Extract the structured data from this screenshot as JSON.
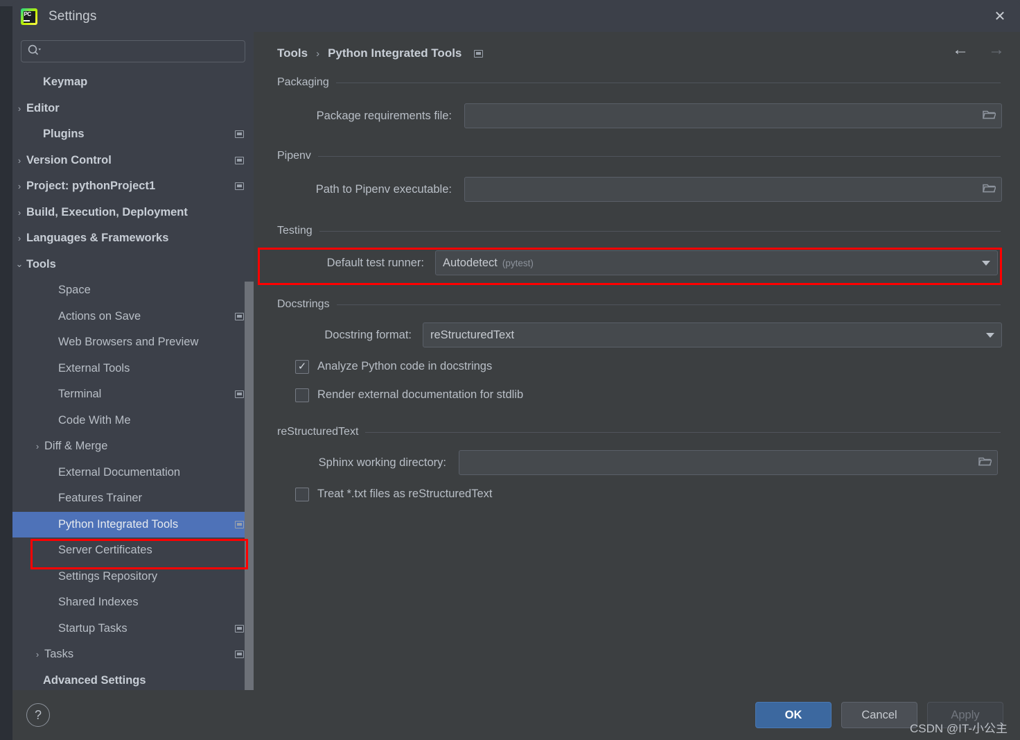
{
  "window": {
    "title": "Settings",
    "app_icon": "pycharm-logo",
    "close_icon": "✕"
  },
  "behind": {
    "left_ghost": "....... ....... ... ....... ......",
    "right_ghost": "………  ………"
  },
  "sidebar": {
    "search": {
      "placeholder": "",
      "value": "",
      "icon": "search-icon"
    },
    "items": [
      {
        "label": "Keymap",
        "arrow": "",
        "badge": false,
        "bold": true,
        "indent": 44,
        "selected": false
      },
      {
        "label": "Editor",
        "arrow": "›",
        "badge": false,
        "bold": true,
        "indent": 20,
        "selected": false
      },
      {
        "label": "Plugins",
        "arrow": "",
        "badge": true,
        "bold": true,
        "indent": 44,
        "selected": false
      },
      {
        "label": "Version Control",
        "arrow": "›",
        "badge": true,
        "bold": true,
        "indent": 20,
        "selected": false
      },
      {
        "label": "Project: pythonProject1",
        "arrow": "›",
        "badge": true,
        "bold": true,
        "indent": 20,
        "selected": false
      },
      {
        "label": "Build, Execution, Deployment",
        "arrow": "›",
        "badge": false,
        "bold": true,
        "indent": 20,
        "selected": false
      },
      {
        "label": "Languages & Frameworks",
        "arrow": "›",
        "badge": false,
        "bold": true,
        "indent": 20,
        "selected": false
      },
      {
        "label": "Tools",
        "arrow": "⌄",
        "badge": false,
        "bold": true,
        "indent": 20,
        "selected": false
      },
      {
        "label": "Space",
        "arrow": "",
        "badge": false,
        "bold": false,
        "indent": 66,
        "selected": false
      },
      {
        "label": "Actions on Save",
        "arrow": "",
        "badge": true,
        "bold": false,
        "indent": 66,
        "selected": false
      },
      {
        "label": "Web Browsers and Preview",
        "arrow": "",
        "badge": false,
        "bold": false,
        "indent": 66,
        "selected": false
      },
      {
        "label": "External Tools",
        "arrow": "",
        "badge": false,
        "bold": false,
        "indent": 66,
        "selected": false
      },
      {
        "label": "Terminal",
        "arrow": "",
        "badge": true,
        "bold": false,
        "indent": 66,
        "selected": false
      },
      {
        "label": "Code With Me",
        "arrow": "",
        "badge": false,
        "bold": false,
        "indent": 66,
        "selected": false
      },
      {
        "label": "Diff & Merge",
        "arrow": "›",
        "badge": false,
        "bold": false,
        "indent": 46,
        "selected": false
      },
      {
        "label": "External Documentation",
        "arrow": "",
        "badge": false,
        "bold": false,
        "indent": 66,
        "selected": false
      },
      {
        "label": "Features Trainer",
        "arrow": "",
        "badge": false,
        "bold": false,
        "indent": 66,
        "selected": false
      },
      {
        "label": "Python Integrated Tools",
        "arrow": "",
        "badge": true,
        "bold": false,
        "indent": 66,
        "selected": true
      },
      {
        "label": "Server Certificates",
        "arrow": "",
        "badge": false,
        "bold": false,
        "indent": 66,
        "selected": false
      },
      {
        "label": "Settings Repository",
        "arrow": "",
        "badge": false,
        "bold": false,
        "indent": 66,
        "selected": false
      },
      {
        "label": "Shared Indexes",
        "arrow": "",
        "badge": false,
        "bold": false,
        "indent": 66,
        "selected": false
      },
      {
        "label": "Startup Tasks",
        "arrow": "",
        "badge": true,
        "bold": false,
        "indent": 66,
        "selected": false
      },
      {
        "label": "Tasks",
        "arrow": "›",
        "badge": true,
        "bold": false,
        "indent": 46,
        "selected": false
      },
      {
        "label": "Advanced Settings",
        "arrow": "",
        "badge": false,
        "bold": true,
        "indent": 44,
        "selected": false
      }
    ]
  },
  "breadcrumb": {
    "parent": "Tools",
    "separator": "›",
    "current": "Python Integrated Tools",
    "badge": "settings-link-badge",
    "back_icon": "←",
    "forward_icon": "→"
  },
  "main": {
    "sections": [
      {
        "name": "packaging",
        "title": "Packaging",
        "field": {
          "label": "Package requirements file:",
          "value": "",
          "icon": "folder-icon"
        }
      },
      {
        "name": "pipenv",
        "title": "Pipenv",
        "field": {
          "label": "Path to Pipenv executable:",
          "value": "",
          "icon": "folder-icon"
        }
      },
      {
        "name": "testing",
        "title": "Testing",
        "combo": {
          "label": "Default test runner:",
          "value": "Autodetect",
          "suffix": "(pytest)"
        }
      },
      {
        "name": "docstrings",
        "title": "Docstrings",
        "combo": {
          "label": "Docstring format:",
          "value": "reStructuredText",
          "suffix": ""
        },
        "checkboxes": [
          {
            "label": "Analyze Python code in docstrings",
            "checked": true,
            "tick": "✓"
          },
          {
            "label": "Render external documentation for stdlib",
            "checked": false,
            "tick": ""
          }
        ]
      },
      {
        "name": "restructuredtext",
        "title": "reStructuredText",
        "field": {
          "label": "Sphinx working directory:",
          "value": "",
          "icon": "folder-icon"
        },
        "checkboxes": [
          {
            "label": "Treat *.txt files as reStructuredText",
            "checked": false,
            "tick": ""
          }
        ]
      }
    ]
  },
  "footer": {
    "help_label": "?",
    "ok_label": "OK",
    "cancel_label": "Cancel",
    "apply_label": "Apply"
  },
  "watermark": "CSDN @IT-小公主",
  "colors": {
    "accent": "#4e72b8",
    "ok_button": "#3c689f",
    "annotation": "#ff0000",
    "panel_bg": "#3c3f41",
    "sidebar_bg": "#3c4049",
    "text": "#b9bfc7"
  }
}
